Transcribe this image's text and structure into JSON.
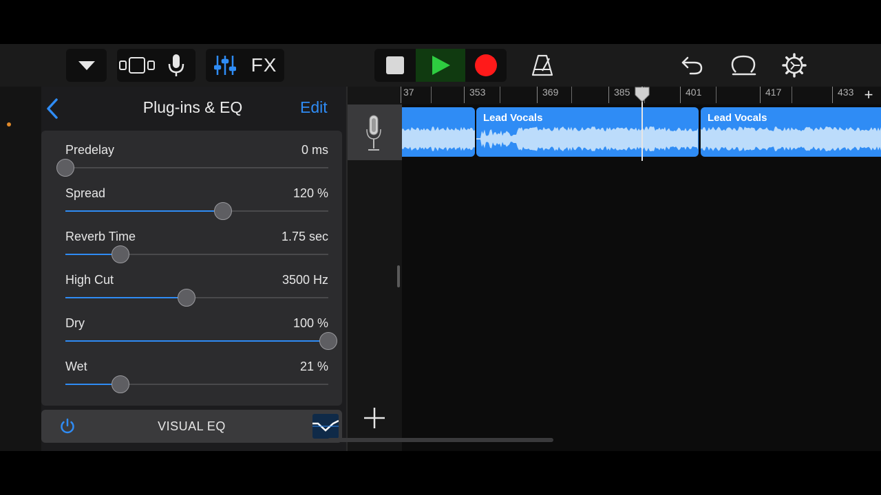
{
  "toolbar": {
    "fx_label": "FX"
  },
  "panel": {
    "title": "Plug-ins & EQ",
    "edit_label": "Edit",
    "params": [
      {
        "label": "Predelay",
        "value": "0 ms",
        "level": 0.0
      },
      {
        "label": "Spread",
        "value": "120 %",
        "level": 0.6
      },
      {
        "label": "Reverb Time",
        "value": "1.75 sec",
        "level": 0.21
      },
      {
        "label": "High Cut",
        "value": "3500 Hz",
        "level": 0.46
      },
      {
        "label": "Dry",
        "value": "100 %",
        "level": 1.0
      },
      {
        "label": "Wet",
        "value": "21 %",
        "level": 0.21
      }
    ],
    "visual_eq_label": "VISUAL EQ"
  },
  "timeline": {
    "ruler_labels": [
      "37",
      "353",
      "369",
      "385",
      "401",
      "417",
      "433"
    ],
    "add_label": "+",
    "regions": [
      {
        "name": ""
      },
      {
        "name": "Lead Vocals"
      },
      {
        "name": "Lead Vocals"
      }
    ]
  },
  "colors": {
    "accent": "#2f8cf5",
    "play": "#2ecc40",
    "record": "#ff1a1a",
    "region": "#2f8cf5"
  },
  "icons": [
    "dropdown-icon",
    "track-view-icon",
    "microphone-icon",
    "mixer-icon",
    "stop-icon",
    "play-icon",
    "record-icon",
    "metronome-icon",
    "undo-icon",
    "loop-icon",
    "settings-icon",
    "back-chevron-icon",
    "power-icon",
    "eq-curve-icon",
    "mic-instrument-icon",
    "add-track-icon"
  ]
}
